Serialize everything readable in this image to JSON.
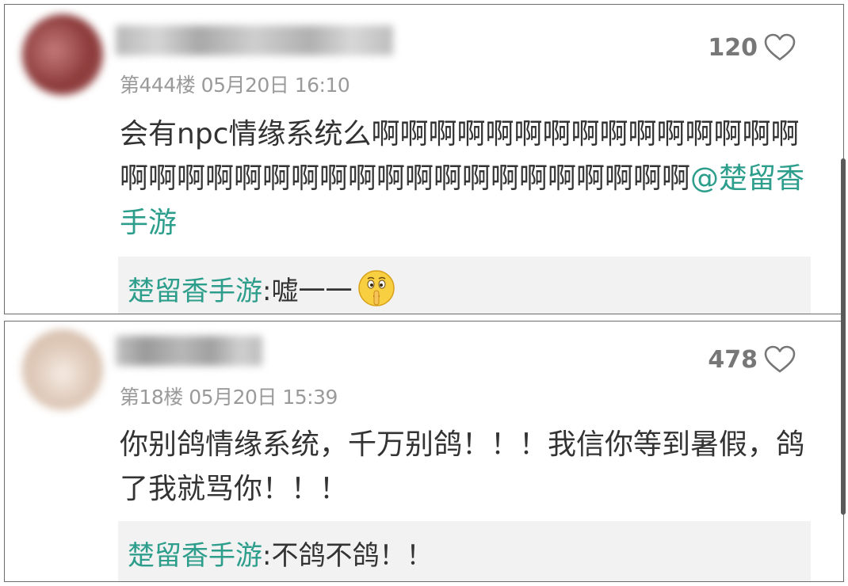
{
  "comments": [
    {
      "avatar_colors": [
        "#8c3a3a",
        "#c47a7a"
      ],
      "floor_time": "第444楼 05月20日 16:10",
      "likes": "120",
      "content_text": "会有npc情缘系统么啊啊啊啊啊啊啊啊啊啊啊啊啊啊啊啊啊啊啊啊啊啊啊啊啊啊啊啊啊啊啊啊啊啊啊",
      "content_mention": "@楚留香手游",
      "reply": {
        "author": "楚留香手游",
        "text": ":嘘一一",
        "emoji": "shush-emoji-icon"
      }
    },
    {
      "avatar_colors": [
        "#d9c4b4",
        "#f0e4da"
      ],
      "floor_time": "第18楼 05月20日 15:39",
      "likes": "478",
      "content_text": "你别鸽情缘系统，千万别鸽！！！我信你等到暑假，鸽了我就骂你！！！",
      "reply": {
        "author": "楚留香手游",
        "text": ":不鸽不鸽！！"
      }
    }
  ],
  "colors": {
    "mention": "#2e9e8c",
    "meta": "#9a9a9a",
    "likes": "#777777",
    "reply_bg": "#f2f2f2"
  }
}
